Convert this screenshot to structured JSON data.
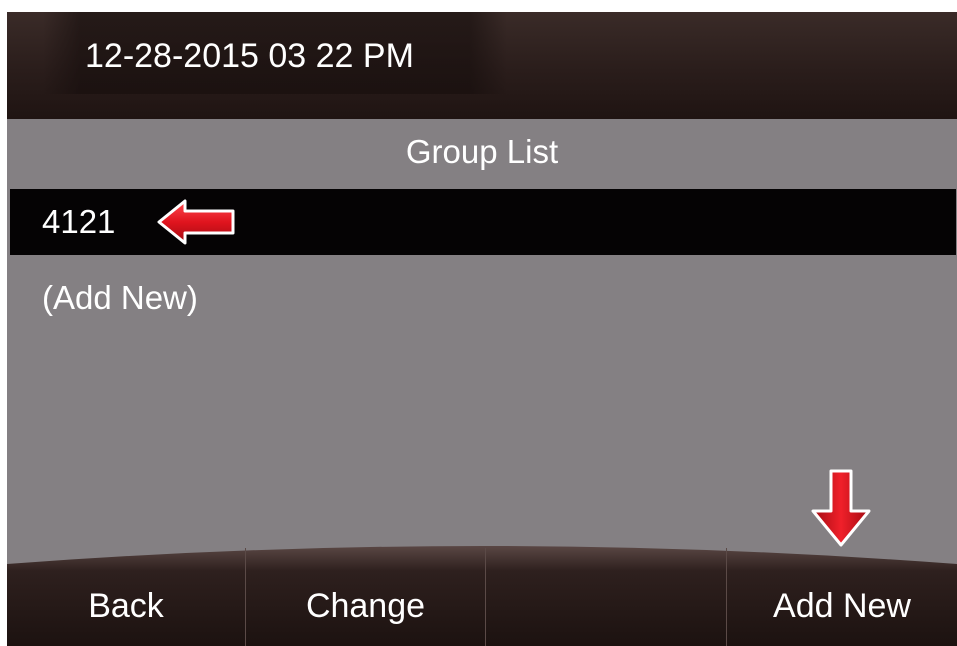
{
  "header": {
    "datetime": "12-28-2015 03 22 PM"
  },
  "list": {
    "title": "Group List",
    "items": [
      {
        "label": "4121",
        "selected": true
      },
      {
        "label": "(Add New)",
        "selected": false
      }
    ]
  },
  "softkeys": [
    {
      "label": "Back"
    },
    {
      "label": "Change"
    },
    {
      "label": ""
    },
    {
      "label": "Add New"
    }
  ],
  "colors": {
    "screen_bg": "#848083",
    "header_bg": "#2a1d1b",
    "selected_row_bg": "#050304",
    "softkey_bg": "#241816",
    "annotation_arrow": "#e0141e",
    "text": "#ffffff"
  },
  "icons": {
    "selected_pointer": "left-arrow-icon",
    "softkey_pointer": "down-arrow-icon"
  }
}
